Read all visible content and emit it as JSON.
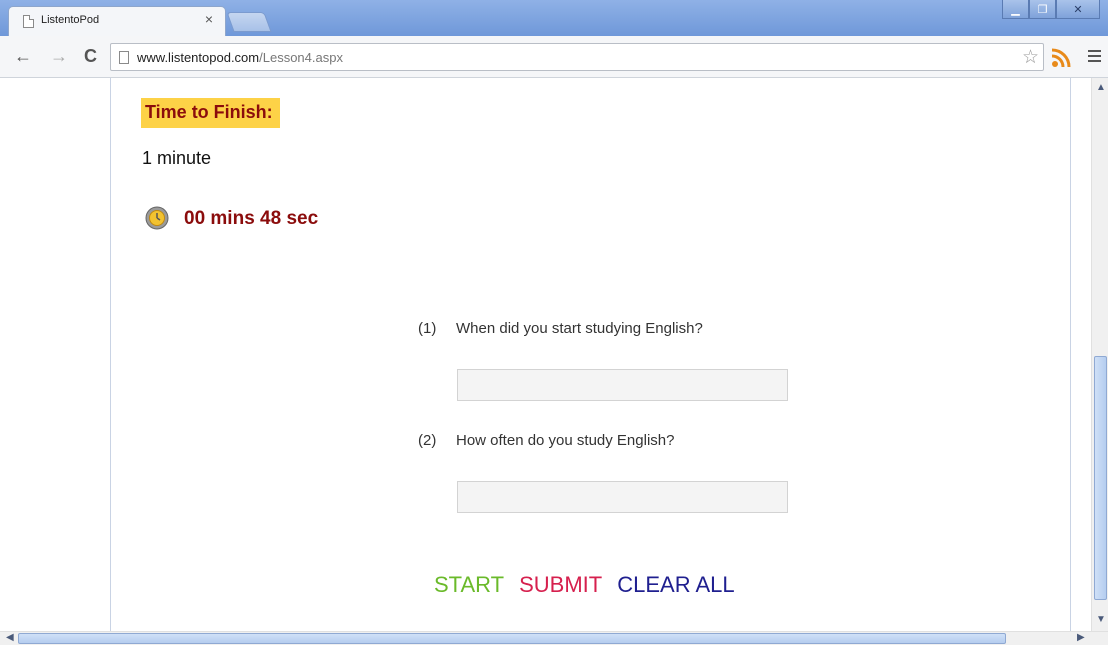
{
  "browser": {
    "tab_title": "ListentoPod",
    "tab_close": "×",
    "url_host": "www.listentopod.com",
    "url_path": "/Lesson4.aspx"
  },
  "lesson": {
    "time_label": "Time to Finish:",
    "duration": "1 minute",
    "timer": "00 mins 48 sec"
  },
  "questions": [
    {
      "num": "(1)",
      "text": "When did you start studying English?",
      "value": ""
    },
    {
      "num": "(2)",
      "text": "How often do you study English?",
      "value": ""
    }
  ],
  "actions": {
    "start": "START",
    "submit": "SUBMIT",
    "clear": "CLEAR ALL"
  },
  "colors": {
    "start": "#6aba2a",
    "submit": "#d6204e",
    "clear": "#1f1f8f",
    "label_bg": "#fdd247",
    "label_text": "#8b0c0c"
  },
  "icons": [
    "page-icon",
    "back-arrow-icon",
    "forward-arrow-icon",
    "reload-icon",
    "star-icon",
    "rss-icon",
    "menu-icon",
    "timer-icon"
  ]
}
